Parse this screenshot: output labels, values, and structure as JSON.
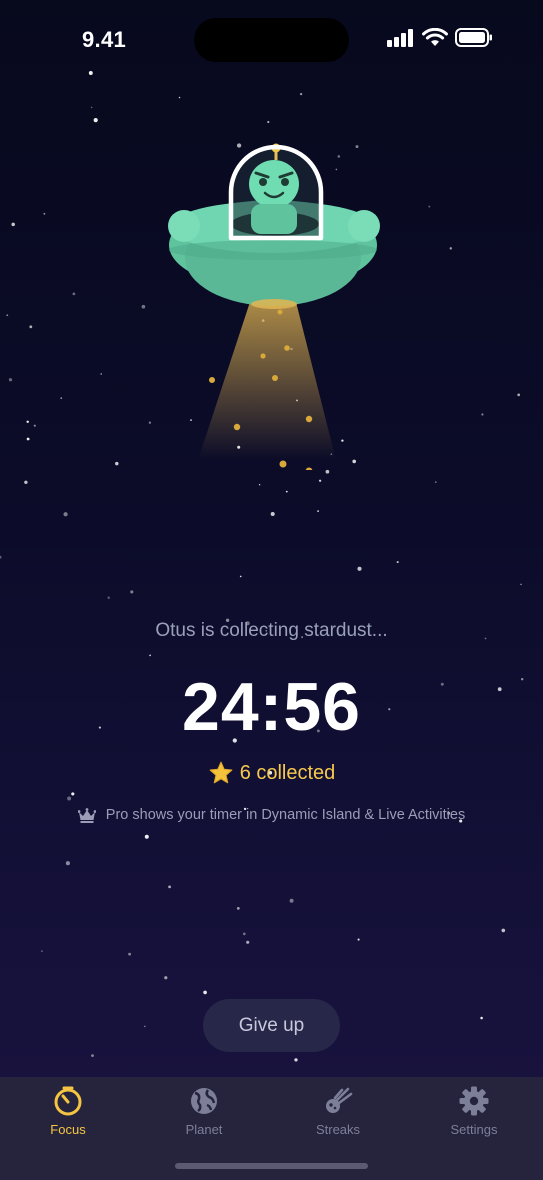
{
  "status_bar": {
    "time": "9.41",
    "icons": [
      "signal-icon",
      "wifi-icon",
      "battery-icon"
    ]
  },
  "mascot": {
    "icon": "ufo-alien-icon"
  },
  "focus": {
    "message": "Otus is collecting stardust...",
    "timer": "24:56",
    "collected_icon": "star-icon",
    "collected": "6 collected",
    "pro_icon": "crown-icon",
    "pro_note": "Pro shows your timer in Dynamic Island & Live Activities"
  },
  "actions": {
    "give_up": "Give up"
  },
  "tab_bar": {
    "tabs": [
      {
        "label": "Focus",
        "icon": "timer-icon",
        "active": true
      },
      {
        "label": "Planet",
        "icon": "globe-icon",
        "active": false
      },
      {
        "label": "Streaks",
        "icon": "meteor-icon",
        "active": false
      },
      {
        "label": "Settings",
        "icon": "gear-icon",
        "active": false
      }
    ]
  },
  "colors": {
    "background_top": "#07091d",
    "background_bottom": "#1a1440",
    "accent": "#f4c542",
    "ufo": "#6ed6b0",
    "tab_bar": "#26243d"
  }
}
